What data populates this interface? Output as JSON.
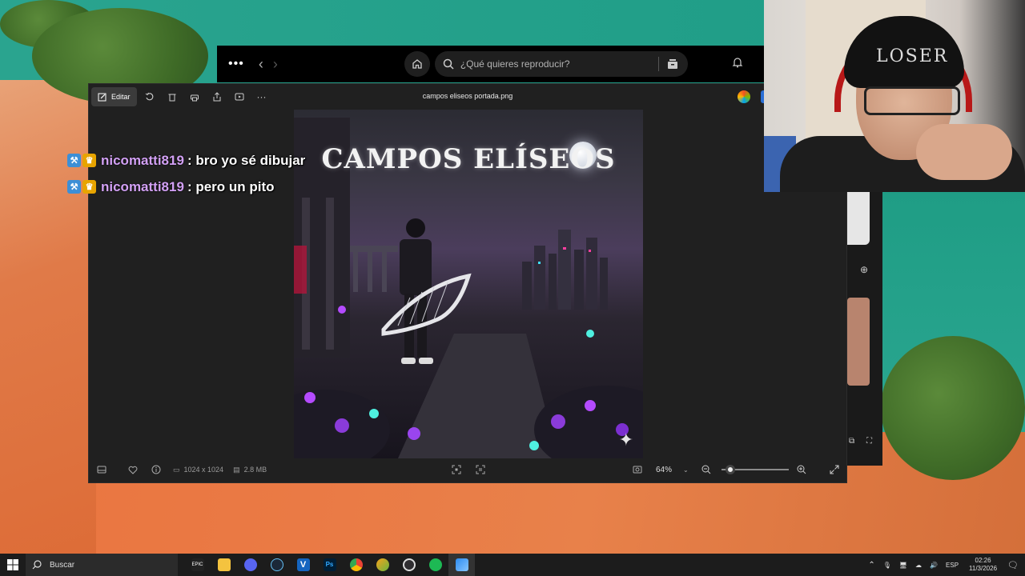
{
  "spotify": {
    "search_placeholder": "¿Qué quieres reproducir?"
  },
  "photos": {
    "edit_label": "Editar",
    "file_title": "campos eliseos portada.png",
    "image_title": "CAMPOS ELÍSEOS",
    "dimensions": "1024 x 1024",
    "file_size": "2.8 MB",
    "zoom": "64%"
  },
  "chat": {
    "messages": [
      {
        "user": "nicomatti819",
        "text": ": bro yo sé dibujar"
      },
      {
        "user": "nicomatti819",
        "text": ": pero un pito"
      }
    ]
  },
  "webcam": {
    "beanie_text": "LOSER"
  },
  "taskbar": {
    "search_label": "Buscar",
    "language": "ESP",
    "time": "02:26",
    "date": "11/3/2026",
    "apps": [
      "epic-games-icon",
      "file-explorer-icon",
      "discord-icon",
      "steam-icon",
      "v-app-icon",
      "photoshop-icon",
      "chrome-icon",
      "fl-studio-icon",
      "obs-icon",
      "spotify-icon",
      "photos-icon"
    ]
  },
  "colors": {
    "chat_user": "#d2a0f5",
    "photos_bg": "#202020",
    "taskbar_bg": "#1c1c1c"
  }
}
